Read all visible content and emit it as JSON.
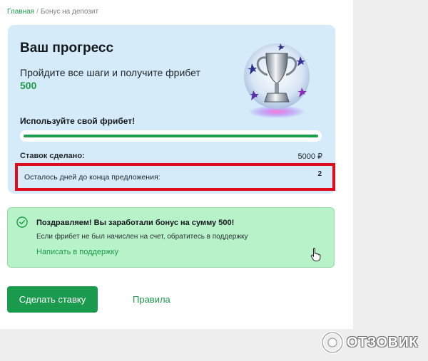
{
  "breadcrumb": {
    "home": "Главная",
    "separator": "/",
    "current": "Бонус на депозит"
  },
  "progress": {
    "title": "Ваш прогресс",
    "subtitle": "Пройдите все шаги и получите фрибет",
    "amount": "500",
    "use_freebet": "Используйте свой фрибет!",
    "progress_fraction": 1.0,
    "bets_label": "Ставок сделано:",
    "bets_value": "5000 ₽",
    "days_label": "Осталось дней до конца предложения:",
    "days_value": "2"
  },
  "congrats": {
    "title": "Поздравляем! Вы заработали бонус на сумму 500!",
    "text": "Если фрибет не был начислен на счет, обратитесь в поддержку",
    "link": "Написать в поддержку"
  },
  "actions": {
    "bet_button": "Сделать ставку",
    "rules_link": "Правила"
  },
  "watermark": {
    "text": "ОТЗОВИК"
  },
  "colors": {
    "accent_green": "#1c9a4a",
    "panel_blue": "#d6ebf9",
    "success_bg": "#b8f2c9",
    "highlight_red": "#e10c1a"
  },
  "icons": {
    "trophy": "trophy-icon",
    "check": "check-circle-icon",
    "cursor": "hand-cursor-icon"
  }
}
